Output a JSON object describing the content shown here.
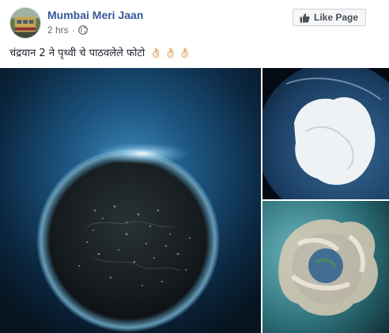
{
  "post": {
    "page_name": "Mumbai Meri Jaan",
    "time": "2 hrs",
    "separator": "·",
    "privacy_icon": "globe-icon",
    "like_button_label": "Like Page",
    "like_icon": "thumbs-up-icon",
    "caption": "चंद्रयान 2 ने पृथ्वी चे पाठवलेले फोटो",
    "caption_emoji": "👌🏻👌🏻👌🏻"
  },
  "photos": [
    {
      "id": "main",
      "description_icon": "earth-night-photo"
    },
    {
      "id": "top-right",
      "description_icon": "earth-ice-photo"
    },
    {
      "id": "bottom-right",
      "description_icon": "earth-clouds-photo"
    }
  ],
  "colors": {
    "link_blue": "#385898",
    "meta_gray": "#616770",
    "button_bg": "#f5f6f7",
    "button_border": "#ccd0d5"
  }
}
